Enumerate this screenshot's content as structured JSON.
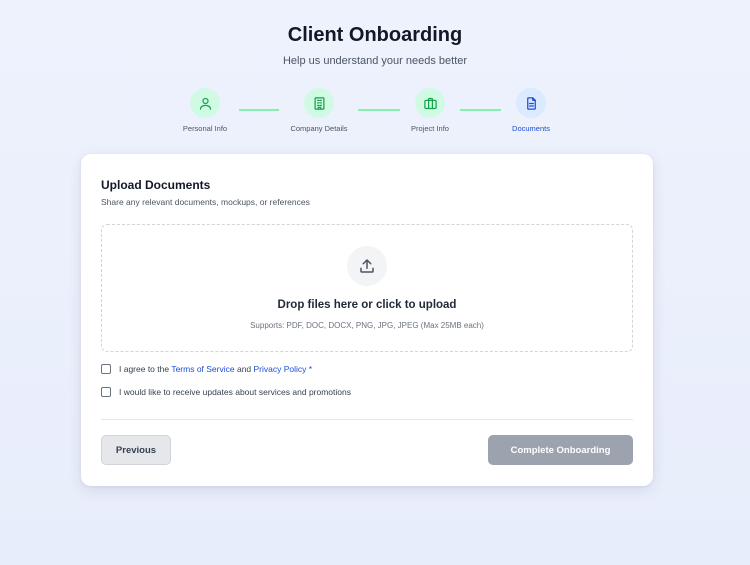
{
  "header": {
    "title": "Client Onboarding",
    "subtitle": "Help us understand your needs better"
  },
  "steps": [
    {
      "label": "Personal Info",
      "icon": "user-icon",
      "state": "complete"
    },
    {
      "label": "Company Details",
      "icon": "building-icon",
      "state": "complete"
    },
    {
      "label": "Project Info",
      "icon": "briefcase-icon",
      "state": "complete"
    },
    {
      "label": "Documents",
      "icon": "document-icon",
      "state": "active"
    }
  ],
  "card": {
    "title": "Upload Documents",
    "description": "Share any relevant documents, mockups, or references",
    "dropzone": {
      "icon": "upload-icon",
      "title": "Drop files here or click to upload",
      "hint": "Supports: PDF, DOC, DOCX, PNG, JPG, JPEG (Max 25MB each)"
    },
    "agree": {
      "prefix": "I agree to the ",
      "terms": "Terms of Service",
      "and": " and ",
      "privacy": "Privacy Policy",
      "required": " *",
      "checked": false
    },
    "updates": {
      "label": "I would like to receive updates about services and promotions",
      "checked": false
    },
    "buttons": {
      "previous": "Previous",
      "complete": "Complete Onboarding"
    }
  },
  "colors": {
    "complete": "#16a34a",
    "complete_bg": "#d1fae5",
    "active": "#1d4ed8",
    "active_bg": "#dbeafe",
    "disabled_button": "#9ca3af"
  }
}
